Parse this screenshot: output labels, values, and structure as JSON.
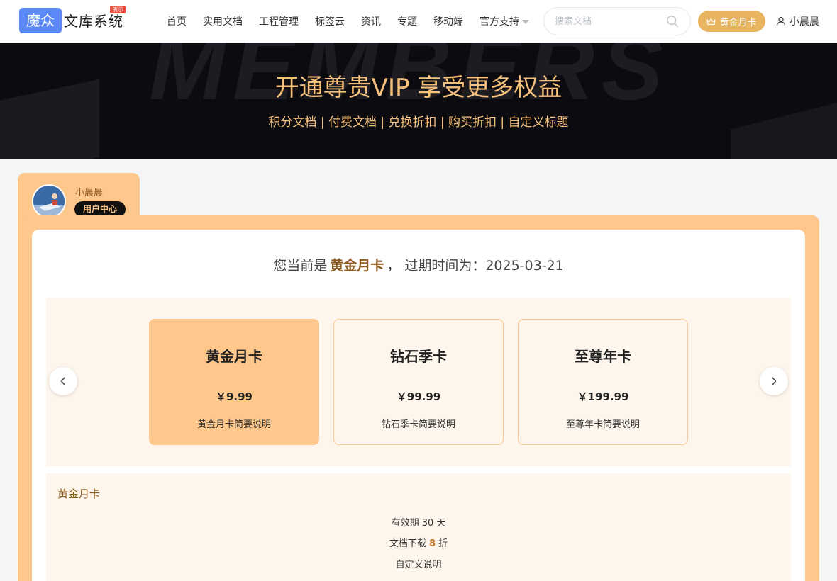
{
  "header": {
    "logo_mark": "魔众",
    "logo_text": "文库系统",
    "logo_badge": "演示",
    "nav": [
      "首页",
      "实用文档",
      "工程管理",
      "标签云",
      "资讯",
      "专题",
      "移动端",
      "官方支持"
    ],
    "search_placeholder": "搜索文档",
    "vip_label": "黄金月卡",
    "user_label": "小晨晨"
  },
  "banner": {
    "bg_text": "MEMBERS",
    "title": "开通尊贵VIP 享受更多权益",
    "subtitle": "积分文档 | 付费文档 | 兑换折扣 | 购买折扣 | 自定义标题"
  },
  "user": {
    "name": "小晨晨",
    "center_label": "用户中心"
  },
  "status": {
    "prefix": "您当前是",
    "plan": "黄金月卡",
    "suffix": "， 过期时间为：2025-03-21"
  },
  "plans": [
    {
      "name": "黄金月卡",
      "price": "￥9.99",
      "desc": "黄金月卡简要说明"
    },
    {
      "name": "钻石季卡",
      "price": "￥99.99",
      "desc": "钻石季卡简要说明"
    },
    {
      "name": "至尊年卡",
      "price": "￥199.99",
      "desc": "至尊年卡简要说明"
    }
  ],
  "details": {
    "title": "黄金月卡",
    "validity_prefix": "有效期",
    "validity_value": "30",
    "validity_suffix": "天",
    "discount_prefix": "文档下载",
    "discount_value": "8",
    "discount_suffix": "折",
    "custom": "自定义说明"
  },
  "colors": {
    "accent": "#fec78b",
    "gold": "#e8b460",
    "brand": "#5b8af8",
    "banner_text": "#f6c07a"
  }
}
